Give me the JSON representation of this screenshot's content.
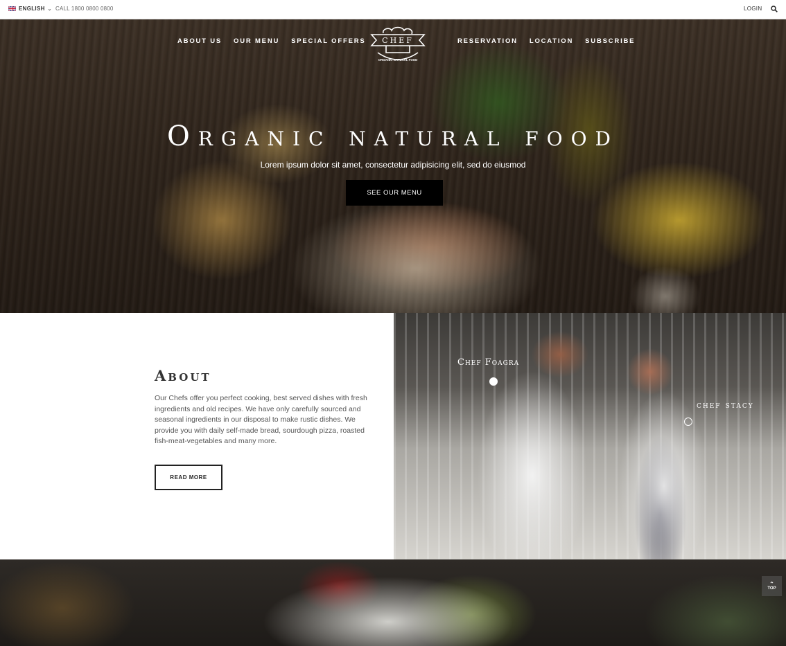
{
  "topbar": {
    "language": "ENGLISH",
    "phone": "CALL 1800 0800 0800",
    "login": "LOGIN",
    "search_icon": "search-icon",
    "flag_icon": "uk-flag-icon"
  },
  "nav": {
    "left": [
      "ABOUT US",
      "OUR MENU",
      "SPECIAL OFFERS"
    ],
    "right": [
      "RESERVATION",
      "LOCATION",
      "SUBSCRIBE"
    ]
  },
  "logo": {
    "name": "CHEF",
    "tagline": "ORGANIC NATURAL FOOD"
  },
  "hero": {
    "title": "Organic natural food",
    "subtitle": "Lorem ipsum dolor sit amet, consectetur adipisicing elit, sed do eiusmod",
    "button": "SEE OUR MENU"
  },
  "about": {
    "title": "About",
    "text": "Our Chefs offer you perfect cooking, best served dishes with fresh ingredients and old recipes. We have only carefully sourced and seasonal ingredients in our disposal to make rustic dishes. We provide you with daily self-made bread, sourdough pizza, roasted fish-meat-vegetables and many more.",
    "button": "READ MORE"
  },
  "chefs": {
    "first": "Chef Foagra",
    "second": "chef stacy"
  },
  "back_to_top": "TOP",
  "colors": {
    "accent": "#000000",
    "text": "#333333"
  }
}
